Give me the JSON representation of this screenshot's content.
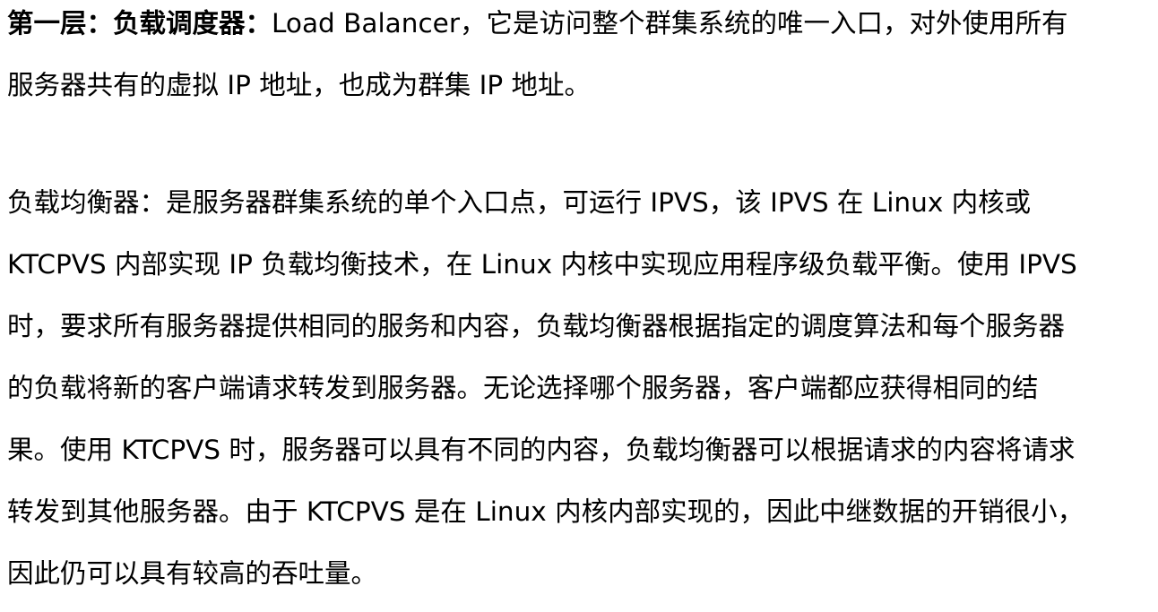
{
  "paragraph1": {
    "bold_label": "第一层：负载调度器：",
    "lines": [
      "Load Balancer，它是访问整个群集系统的唯一入口，对外使用所有",
      "服务器共有的虚拟 IP 地址，也成为群集 IP 地址。"
    ]
  },
  "paragraph2": {
    "lines": [
      "负载均衡器：是服务器群集系统的单个入口点，可运行 IPVS，该 IPVS 在 Linux 内核或",
      "KTCPVS 内部实现 IP 负载均衡技术，在 Linux 内核中实现应用程序级负载平衡。使用 IPVS",
      "时，要求所有服务器提供相同的服务和内容，负载均衡器根据指定的调度算法和每个服务器",
      "的负载将新的客户端请求转发到服务器。无论选择哪个服务器，客户端都应获得相同的结",
      "果。使用 KTCPVS 时，服务器可以具有不同的内容，负载均衡器可以根据请求的内容将请求",
      "转发到其他服务器。由于 KTCPVS 是在 Linux 内核内部实现的，因此中继数据的开销很小，",
      "因此仍可以具有较高的吞吐量。"
    ]
  }
}
